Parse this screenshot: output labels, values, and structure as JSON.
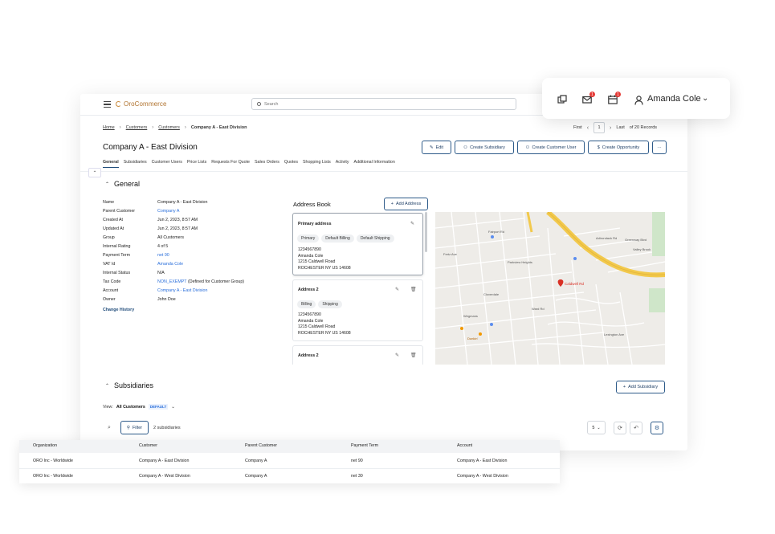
{
  "colors": {
    "primary": "#1f4b7a",
    "link": "#2a6fdb",
    "brand": "#b0722d",
    "notification": "#e53935"
  },
  "topbar": {
    "logo": "OroCommerce",
    "search_placeholder": "Search",
    "menu_icon": "hamburger-icon"
  },
  "userbar": {
    "user_name": "Amanda Cole",
    "mail_count": "1",
    "calendar_count": "1"
  },
  "breadcrumb": {
    "items": [
      "Home",
      "Customers",
      "Customers"
    ],
    "current": "Company A - East Division"
  },
  "pager": {
    "first": "First",
    "page": "1",
    "last": "Last",
    "of_records": "of 20 Records"
  },
  "page": {
    "title": "Company A - East Division"
  },
  "actions": {
    "edit": "Edit",
    "create_subsidiary": "Create Subsidiary",
    "create_customer_user": "Create Customer User",
    "create_opportunity": "Create Opportunity",
    "more": "···"
  },
  "tabs": [
    "General",
    "Subsidiaries",
    "Customer Users",
    "Price Lists",
    "Requests For Quote",
    "Sales Orders",
    "Quotes",
    "Shopping Lists",
    "Activity",
    "Additional Information"
  ],
  "general": {
    "heading": "General",
    "fields": [
      {
        "label": "Name",
        "value": "Company A - East Division"
      },
      {
        "label": "Parent Customer",
        "value": "Company A"
      },
      {
        "label": "Created At",
        "value": "Jun 2, 2023, 8:57 AM"
      },
      {
        "label": "Updated At",
        "value": "Jun 2, 2023, 8:57 AM"
      },
      {
        "label": "Group",
        "value": "All Customers"
      },
      {
        "label": "Internal Rating",
        "value": "4 of 5"
      },
      {
        "label": "Payment Term",
        "value": "net 90"
      },
      {
        "label": "VAT Id",
        "value": "Amanda Cole"
      },
      {
        "label": "Internal Status",
        "value": "N/A"
      },
      {
        "label": "Tax Code",
        "value": "NON_EXEMPT",
        "note": "(Defined for Customer Group)"
      },
      {
        "label": "Account",
        "value": "Company A - East Division"
      },
      {
        "label": "Owner",
        "value": "John Doe"
      }
    ],
    "change_history": "Change History"
  },
  "address_book": {
    "title": "Address Book",
    "add_button": "Add Address",
    "cards": [
      {
        "title": "Primary address",
        "tags": [
          "Primary",
          "Default Billing",
          "Default Shipping"
        ],
        "lines": [
          "1234567890",
          "Amanda Cole",
          "1215 Caldwell Road",
          "ROCHESTER NY US 14608"
        ]
      },
      {
        "title": "Address 2",
        "tags": [
          "Billing",
          "Shipping"
        ],
        "lines": [
          "1234567890",
          "Amanda Cole",
          "1215 Caldwell Road",
          "ROCHESTER NY US 14608"
        ]
      },
      {
        "title": "Address 2",
        "tags": [],
        "lines": []
      }
    ]
  },
  "map": {
    "labels": [
      "Caldwell Rd",
      "Fairport Rd",
      "Dunkin'",
      "Adirondack Rd",
      "Parkview Heights",
      "Wegmans",
      "Greenway Blvd",
      "Valley Brook",
      "Cloverdale",
      "Ward Rd",
      "Fretz Ave",
      "Lexington Ave"
    ]
  },
  "subsidiaries": {
    "heading": "Subsidiaries",
    "add_button": "Add Subsidiary",
    "view_label": "View:",
    "view_name": "All Customers",
    "default_badge": "DEFAULT",
    "filter": "Filter",
    "count": "2 subsidiaries",
    "page_size": "5",
    "columns": [
      "Organization",
      "Customer",
      "Parent Customer",
      "Payment Term",
      "Account"
    ],
    "rows": [
      [
        "ORO Inc - Worldwide",
        "Company A - East Division",
        "Company A",
        "net 90",
        "Company A - East Division"
      ],
      [
        "ORO Inc - Worldwide",
        "Company A - West Division",
        "Company A",
        "net 30",
        "Company A - West Division"
      ]
    ]
  }
}
